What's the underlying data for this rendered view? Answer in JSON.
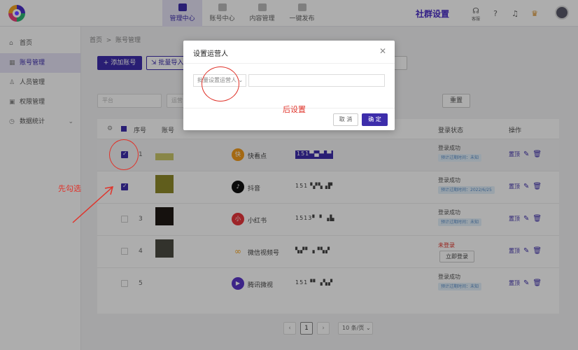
{
  "header": {
    "nav": [
      {
        "label": "管理中心",
        "icon": "monitor-icon",
        "active": true
      },
      {
        "label": "账号中心",
        "icon": "user-icon",
        "active": false
      },
      {
        "label": "内容管理",
        "icon": "document-icon",
        "active": false
      },
      {
        "label": "一键发布",
        "icon": "play-icon",
        "active": false
      }
    ],
    "brand": "社群设置",
    "service_label": "客服"
  },
  "sidebar": {
    "items": [
      {
        "label": "首页",
        "icon": "home-icon"
      },
      {
        "label": "账号管理",
        "icon": "grid-icon",
        "active": true
      },
      {
        "label": "人员管理",
        "icon": "person-icon"
      },
      {
        "label": "权限管理",
        "icon": "briefcase-icon"
      },
      {
        "label": "数据统计",
        "icon": "clock-icon"
      }
    ]
  },
  "breadcrumb": {
    "root": "首页",
    "sep": ">",
    "current": "账号管理"
  },
  "toolbar": {
    "add_label": "添加账号",
    "batch_label": "批量导入"
  },
  "filters": {
    "platform_placeholder": "平台",
    "operator_placeholder": "运营",
    "reset_label": "重置"
  },
  "table": {
    "headers": {
      "index": "序号",
      "account": "账号",
      "status": "登录状态",
      "ops": "操作"
    },
    "rows": [
      {
        "index": "1",
        "checked": true,
        "thumb_color": "#c9c66a",
        "platform": "快看点",
        "plat_color": "#f29b1d",
        "plat_glyph": "快",
        "account": "151▀▄▀ ▀",
        "highlight": true,
        "status": "登录成功",
        "status_error": false,
        "expire": "预计过期时间：未知"
      },
      {
        "index": "",
        "checked": true,
        "thumb_color": "#8e8a2a",
        "platform": "抖音",
        "plat_color": "#111111",
        "plat_glyph": "♪",
        "account": "151▝▞▚▗▛",
        "highlight": false,
        "status": "登录成功",
        "status_error": false,
        "expire": "预计过期时间：2022/6/25"
      },
      {
        "index": "3",
        "checked": false,
        "thumb_color": "#1f1a16",
        "platform": "小红书",
        "plat_color": "#e8363b",
        "plat_glyph": "小",
        "account": "1513▘▝ ▗▙",
        "highlight": false,
        "status": "登录成功",
        "status_error": false,
        "expire": "预计过期时间：未知"
      },
      {
        "index": "4",
        "checked": false,
        "thumb_color": "#4a4a42",
        "platform": "微信视频号",
        "plat_color": "#f6a623",
        "plat_glyph": "∞",
        "account": "▚▞▘▗▝▚▞",
        "highlight": false,
        "status": "未登录",
        "status_error": true,
        "login_label": "立即登录"
      },
      {
        "index": "5",
        "checked": false,
        "thumb_color": "",
        "platform": "腾讯微视",
        "plat_color": "#5b35c9",
        "plat_glyph": "▶",
        "account": "151▝▘▗▚▞",
        "highlight": false,
        "status": "登录成功",
        "status_error": false,
        "expire": "预计过期时间：未知"
      }
    ],
    "op_top": "置顶"
  },
  "pager": {
    "current": "1",
    "size_label": "10 条/页"
  },
  "dialog": {
    "title": "设置运营人",
    "label": "批量设置运营人",
    "cancel": "取 消",
    "ok": "确 定"
  },
  "annotations": {
    "after": "后设置",
    "first": "先勾选"
  }
}
